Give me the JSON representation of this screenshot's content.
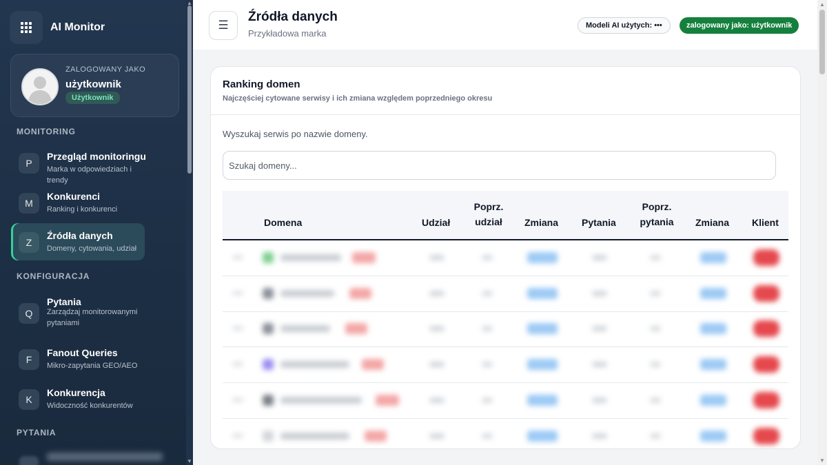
{
  "app": {
    "title": "AI Monitor"
  },
  "user": {
    "caption": "ZALOGOWANY JAKO",
    "name": "użytkownik",
    "role": "Użytkownik"
  },
  "sidebar": {
    "sections": {
      "monitoring": "MONITORING",
      "config": "KONFIGURACJA",
      "questions": "PYTANIA"
    },
    "items": [
      {
        "badge": "P",
        "title": "Przegląd monitoringu",
        "sub": "Marka w odpowiedziach i trendy",
        "active": false
      },
      {
        "badge": "M",
        "title": "Konkurenci",
        "sub": "Ranking i konkurenci",
        "active": false
      },
      {
        "badge": "Z",
        "title": "Źródła danych",
        "sub": "Domeny, cytowania, udział",
        "active": true
      },
      {
        "badge": "Q",
        "title": "Pytania",
        "sub": "Zarządzaj monitorowanymi pytaniami",
        "active": false
      },
      {
        "badge": "F",
        "title": "Fanout Queries",
        "sub": "Mikro-zapytania GEO/AEO",
        "active": false
      },
      {
        "badge": "K",
        "title": "Konkurencja",
        "sub": "Widoczność konkurentów",
        "active": false
      }
    ]
  },
  "header": {
    "menu_icon": "☰",
    "title": "Źródła danych",
    "subtitle": "Przykładowa marka",
    "models_pill": "Modeli AI użytych: •••",
    "user_pill": "zalogowany jako: użytkownik"
  },
  "card": {
    "title": "Ranking domen",
    "subtitle": "Najczęściej cytowane serwisy i ich zmiana względem poprzedniego okresu",
    "search_hint": "Wyszukaj serwis po nazwie domeny.",
    "search_placeholder": "Szukaj domeny...",
    "columns": {
      "domain": "Domena",
      "share": "Udział",
      "prev_share_1": "Poprz.",
      "prev_share_2": "udział",
      "change_1": "Zmiana",
      "questions": "Pytania",
      "prev_q_1": "Poprz.",
      "prev_q_2": "pytania",
      "change_2": "Zmiana",
      "client": "Klient"
    }
  },
  "colors": {
    "sidebar_bg": "#1f3148",
    "active_accent": "#34d399",
    "user_pill": "#15803d",
    "client_badge": "#e5484d",
    "change_chip": "#60a5fa"
  }
}
